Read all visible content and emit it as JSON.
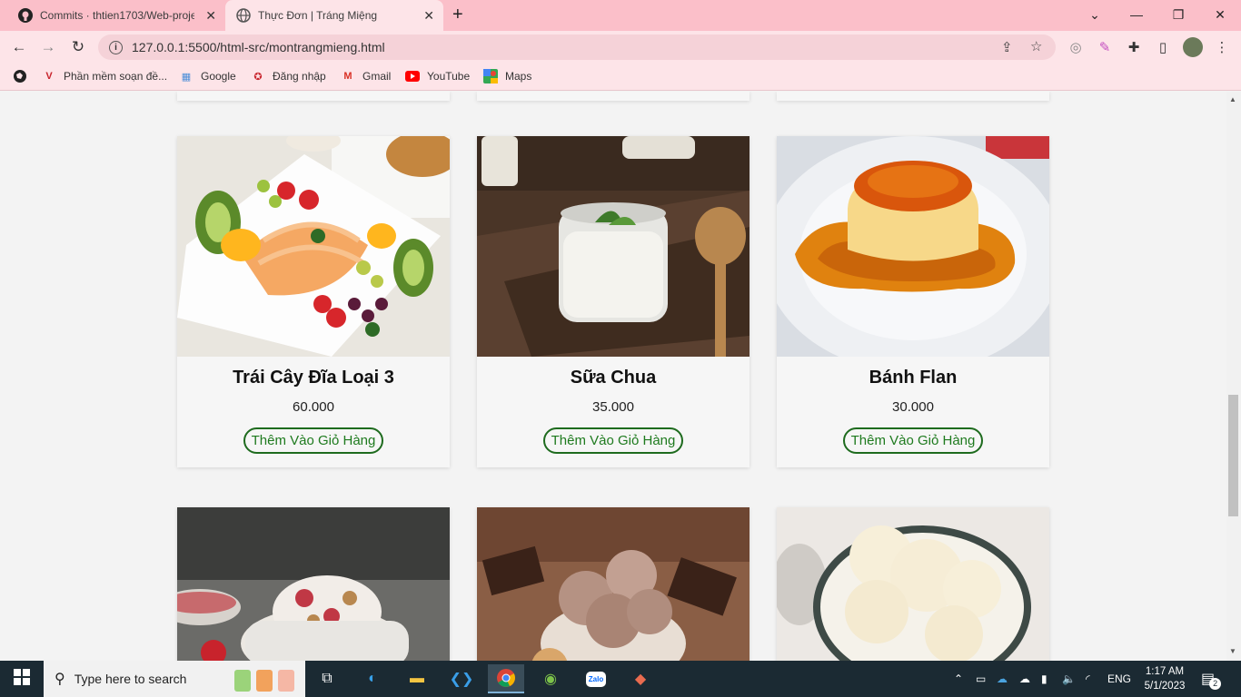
{
  "browser": {
    "tabs": [
      {
        "title": "Commits · thtien1703/Web-proje",
        "icon": "github-icon"
      },
      {
        "title": "Thực Đơn | Tráng Miệng",
        "icon": "globe-icon"
      }
    ],
    "url": "127.0.0.1:5500/html-src/montrangmieng.html",
    "bookmarks": [
      {
        "label": "Phần mềm soạn đề...",
        "icon": "v-logo-icon"
      },
      {
        "label": "Google",
        "icon": "google-icon"
      },
      {
        "label": "Đăng nhập",
        "icon": "login-icon"
      },
      {
        "label": "Gmail",
        "icon": "gmail-icon"
      },
      {
        "label": "YouTube",
        "icon": "youtube-icon"
      },
      {
        "label": "Maps",
        "icon": "maps-icon"
      }
    ]
  },
  "products": [
    {
      "name": "Trái Cây Đĩa Loại 3",
      "price": "60.000",
      "button": "Thêm Vào Giỏ Hàng",
      "image": "fruit-platter-image"
    },
    {
      "name": "Sữa Chua",
      "price": "35.000",
      "button": "Thêm Vào Giỏ Hàng",
      "image": "yogurt-image"
    },
    {
      "name": "Bánh Flan",
      "price": "30.000",
      "button": "Thêm Vào Giỏ Hàng",
      "image": "flan-image"
    }
  ],
  "next_row_images": [
    "strawberry-ice-cream-image",
    "chocolate-ice-cream-image",
    "vanilla-ice-cream-image"
  ],
  "taskbar": {
    "search_placeholder": "Type here to search",
    "language": "ENG",
    "time": "1:17 AM",
    "date": "5/1/2023",
    "notification_count": "2"
  },
  "colors": {
    "tab_strip": "#fbbfc9",
    "toolbar": "#fde4e8",
    "button_border": "#1e6b1e",
    "page_bg": "#f3f3f3",
    "taskbar": "#1b2a33"
  }
}
